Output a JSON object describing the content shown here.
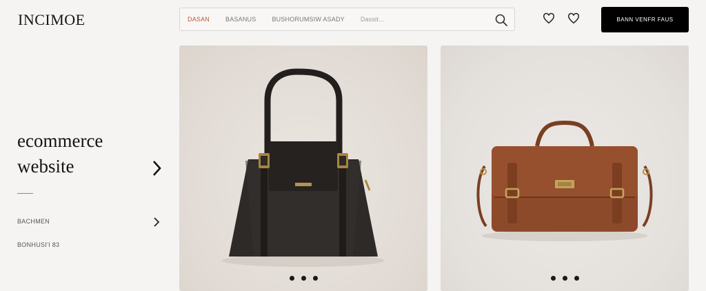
{
  "header": {
    "logo": "INCIMOE",
    "search": {
      "tabs": [
        "DASAN",
        "BASANUS",
        "BUSHORUMSIW ASADY"
      ],
      "placeholder": "Dassit...",
      "icon": "search-icon"
    },
    "icons": [
      "heart-outline-icon",
      "heart-icon"
    ],
    "cta_label": "BANN VENFR FAUS"
  },
  "sidebar": {
    "title_line1": "ecommerce",
    "title_line2": "website",
    "links": [
      "BACHMEN",
      "BONHUSI'I 83"
    ]
  },
  "products": [
    {
      "name": "black-leather-tote",
      "color": "#2b2826",
      "carousel_dots": 3
    },
    {
      "name": "brown-leather-satchel",
      "color": "#8b4a2b",
      "carousel_dots": 3
    }
  ],
  "colors": {
    "accent": "#c0533c",
    "button_bg": "#000000",
    "background": "#f5f4f2"
  }
}
